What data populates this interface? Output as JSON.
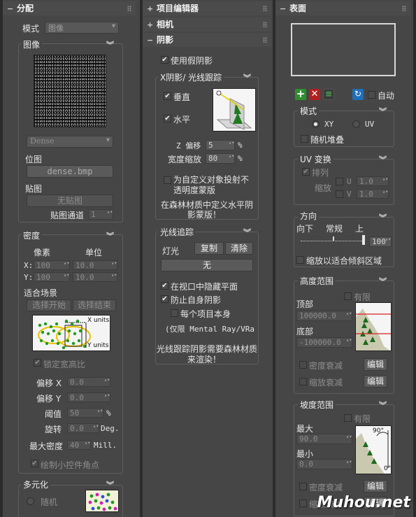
{
  "left": {
    "title": "分配",
    "mode_label": "模式",
    "mode_value": "图像",
    "image_group": "图像",
    "dense_value": "Dense",
    "bitmap_label": "位图",
    "bitmap_button": "dense.bmp",
    "map_label": "贴图",
    "map_button": "无贴图",
    "map_channel_label": "贴图通道",
    "map_channel_value": "1",
    "density_group": "密度",
    "pixel_header": "像素",
    "unit_header": "单位",
    "x_label": "X:",
    "y_label": "Y:",
    "x_pixel": "100",
    "x_unit": "10.0",
    "y_pixel": "100",
    "y_unit": "10.0",
    "fit_scene_label": "适合场景",
    "select_start": "选择开始",
    "select_end": "选择结束",
    "x_units_label": "X units",
    "y_units_label": "Y units",
    "lock_aspect": "锁定宽高比",
    "offset_x_label": "偏移 X",
    "offset_x_value": "0.0",
    "offset_y_label": "偏移 Y",
    "offset_y_value": "0.0",
    "threshold_label": "阈值",
    "threshold_value": "50",
    "threshold_unit": "%",
    "rotation_label": "旋转",
    "rotation_value": "0.0",
    "rotation_unit": "Deg.",
    "max_density_label": "最大密度",
    "max_density_value": "40",
    "max_density_unit": "Mill.",
    "draw_corners": "绘制小控件角点",
    "diversity_group": "多元化",
    "random_label": "随机"
  },
  "middle": {
    "project_editor": "项目编辑器",
    "camera": "相机",
    "shadow_title": "阴影",
    "use_fake_shadow": "使用假阴影",
    "xshadow_group": "X阴影/ 光线跟踪",
    "vertical": "垂直",
    "horizontal": "水平",
    "z_offset_label": "Z 偏移",
    "z_offset_value": "5",
    "z_offset_unit": "%",
    "width_scale_label": "宽度缩放",
    "width_scale_value": "80",
    "width_scale_unit": "%",
    "custom_opacity_line1": "为自定义对象投射不",
    "custom_opacity_line2": "透明度蒙版",
    "forest_note_line1": "在森林材质中定义水平阴",
    "forest_note_line2": "影蒙版！",
    "raytrace_group": "光线追踪",
    "lights_label": "灯光",
    "copy_button": "复制",
    "clear_button": "清除",
    "none_button": "无",
    "hide_in_viewport": "在视口中隐藏平面",
    "prevent_self_shadow": "防止自身阴影",
    "per_item": "每个项目本身",
    "mentalray_note": "(仅限 Mental Ray/VRa",
    "raytrace_note_line1": "光线跟踪阴影需要森林材质",
    "raytrace_note_line2": "来渲染！"
  },
  "right": {
    "title": "表面",
    "auto_label": "自动",
    "mode_group": "模式",
    "xy_label": "XY",
    "uv_label": "UV",
    "random_stack": "随机堆叠",
    "uv_transform_group": "UV 变换",
    "tile_label": "排列",
    "scale_label": "缩放",
    "u_label": "U",
    "v_label": "V",
    "u_value": "1.0",
    "v_value": "1.0",
    "direction_group": "方向",
    "down_label": "向下",
    "normal_label": "常规",
    "up_label": "上",
    "direction_value": "100",
    "scale_to_slope": "缩放以适合倾斜区域",
    "height_group": "高度范围",
    "limited_label": "有限",
    "top_label": "顶部",
    "top_value": "100000.0",
    "bottom_label": "底部",
    "bottom_value": "-100000.0",
    "density_falloff": "密度衰减",
    "scale_falloff": "缩放衰减",
    "edit_button": "编辑",
    "slope_group": "坡度范围",
    "max_label": "最大",
    "max_value": "90.0",
    "min_label": "最小",
    "min_value": "0.0",
    "angle_top": "90°",
    "angle_bottom": "0°"
  },
  "watermark": "Muhou.net"
}
